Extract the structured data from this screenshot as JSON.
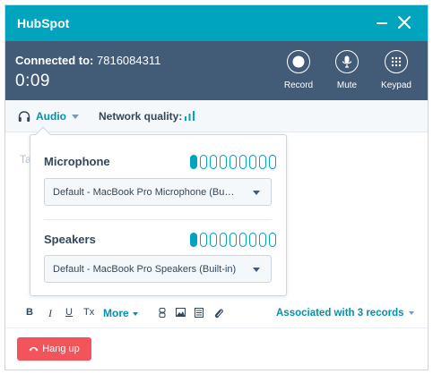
{
  "window": {
    "title": "HubSpot"
  },
  "call": {
    "connected_label": "Connected to:",
    "phone_number": "7816084311",
    "timer": "0:09",
    "controls": [
      {
        "label": "Record",
        "icon": "record-icon"
      },
      {
        "label": "Mute",
        "icon": "microphone-icon"
      },
      {
        "label": "Keypad",
        "icon": "keypad-icon"
      }
    ]
  },
  "status": {
    "audio_label": "Audio",
    "network_label": "Network quality:",
    "network_icon": "signal-bars-icon"
  },
  "note": {
    "placeholder": "Ta"
  },
  "audio_popover": {
    "microphone": {
      "title": "Microphone",
      "device": "Default - MacBook Pro Microphone (Bu…",
      "level": 1,
      "segments": 9
    },
    "speakers": {
      "title": "Speakers",
      "device": "Default - MacBook Pro Speakers (Built-in)",
      "level": 1,
      "segments": 9
    }
  },
  "toolbar": {
    "bold": "B",
    "italic": "I",
    "underline": "U",
    "clear_format": "Tx",
    "more": "More",
    "associated": "Associated with 3 records"
  },
  "footer": {
    "hangup_label": "Hang up"
  },
  "colors": {
    "teal": "#00a4bd",
    "slate": "#425b76",
    "link": "#0091ae",
    "danger": "#f2545b"
  }
}
